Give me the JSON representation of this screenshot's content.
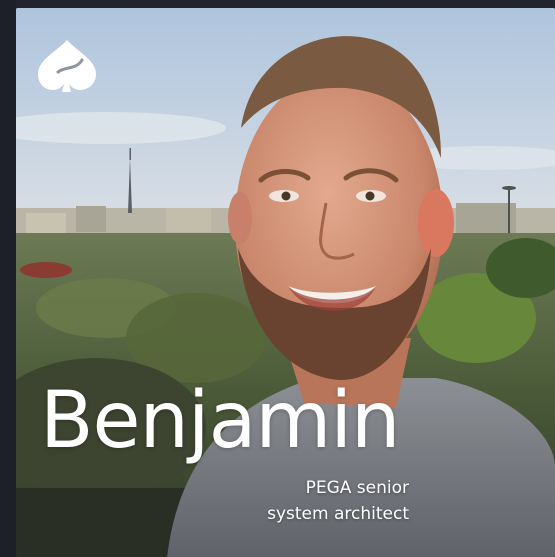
{
  "profile": {
    "name": "Benjamin",
    "role_line1": "PEGA senior",
    "role_line2": "system architect"
  },
  "icons": {
    "brand_logo": "spade-icon"
  },
  "colors": {
    "background": "#1e2029",
    "text": "#ffffff"
  }
}
